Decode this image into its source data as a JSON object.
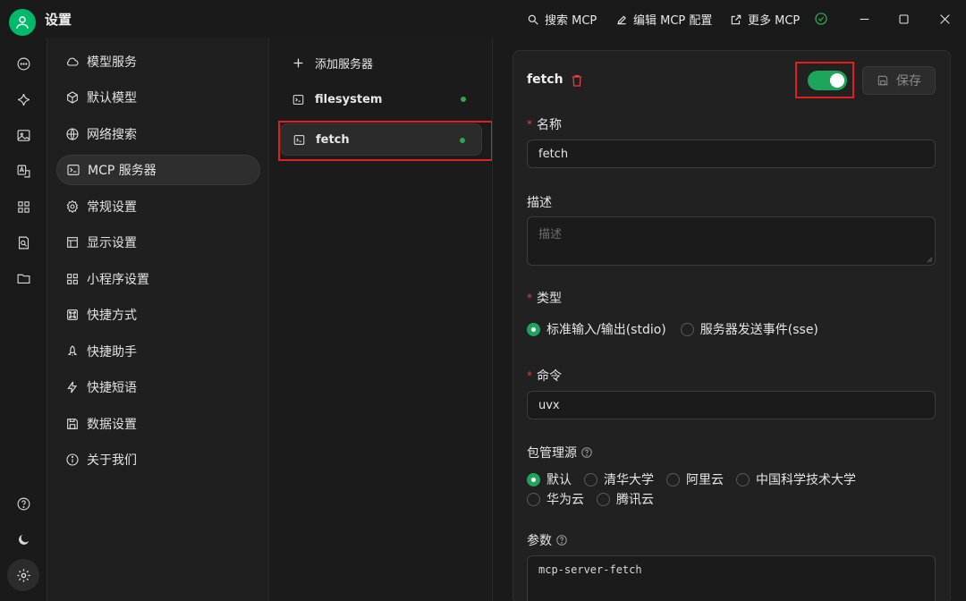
{
  "window": {
    "title": "设置",
    "actions": {
      "search_mcp": "搜索 MCP",
      "edit_mcp_config": "编辑 MCP 配置",
      "more_mcp": "更多 MCP"
    }
  },
  "rail": {
    "icons": [
      "chat-icon",
      "sparkle-icon",
      "image-icon",
      "translate-icon",
      "apps-icon",
      "document-search-icon",
      "folder-icon",
      "help-circle-icon",
      "moon-icon",
      "settings-icon"
    ]
  },
  "settings_nav": {
    "items": [
      {
        "label": "模型服务",
        "icon": "cloud-icon"
      },
      {
        "label": "默认模型",
        "icon": "cube-icon"
      },
      {
        "label": "网络搜索",
        "icon": "globe-icon"
      },
      {
        "label": "MCP 服务器",
        "icon": "terminal-icon",
        "active": true
      },
      {
        "label": "常规设置",
        "icon": "gear-icon"
      },
      {
        "label": "显示设置",
        "icon": "layout-icon"
      },
      {
        "label": "小程序设置",
        "icon": "grid-icon"
      },
      {
        "label": "快捷方式",
        "icon": "command-icon"
      },
      {
        "label": "快捷助手",
        "icon": "rocket-icon"
      },
      {
        "label": "快捷短语",
        "icon": "zap-icon"
      },
      {
        "label": "数据设置",
        "icon": "save-icon"
      },
      {
        "label": "关于我们",
        "icon": "info-icon"
      }
    ]
  },
  "servers": {
    "add_label": "添加服务器",
    "items": [
      {
        "name": "filesystem",
        "status": "active"
      },
      {
        "name": "fetch",
        "status": "active",
        "selected": true
      }
    ]
  },
  "detail": {
    "server_name": "fetch",
    "enabled": true,
    "save_label": "保存",
    "name_label": "名称",
    "name_value": "fetch",
    "description_label": "描述",
    "description_placeholder": "描述",
    "type_label": "类型",
    "type_options": [
      "标准输入/输出(stdio)",
      "服务器发送事件(sse)"
    ],
    "type_selected": "标准输入/输出(stdio)",
    "command_label": "命令",
    "command_value": "uvx",
    "registry_label": "包管理源",
    "registry_options": [
      "默认",
      "清华大学",
      "阿里云",
      "中国科学技术大学",
      "华为云",
      "腾讯云"
    ],
    "registry_selected": "默认",
    "args_label": "参数",
    "args_value": "mcp-server-fetch"
  },
  "colors": {
    "accent": "#1ea55c",
    "highlight_box": "#e02020",
    "status_dot": "#2ea44f"
  }
}
